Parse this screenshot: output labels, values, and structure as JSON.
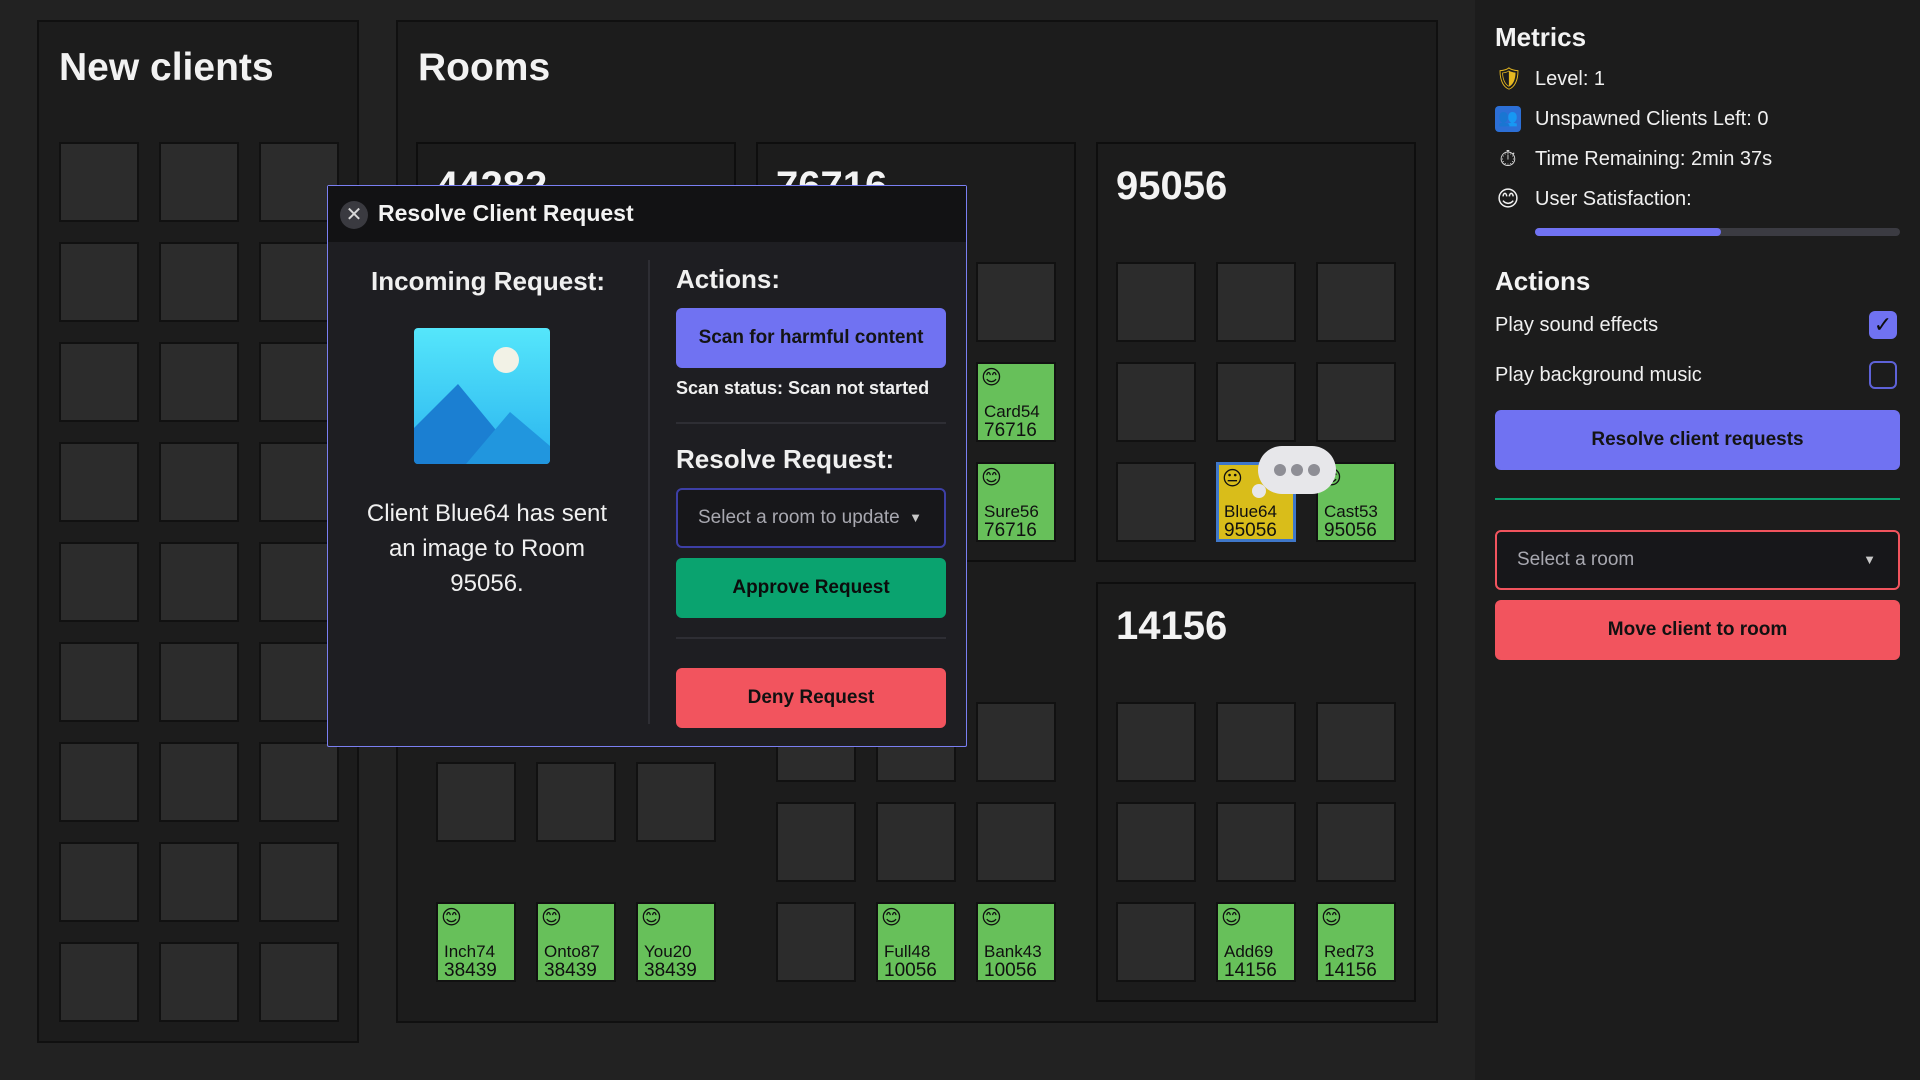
{
  "new_clients": {
    "title": "New clients"
  },
  "rooms_panel": {
    "title": "Rooms"
  },
  "rooms": [
    {
      "number": "44282",
      "clients": [
        {
          "name": "Inch74",
          "room": "38439",
          "emoji": "😊"
        },
        {
          "name": "Onto87",
          "room": "38439",
          "emoji": "😊"
        },
        {
          "name": "You20",
          "room": "38439",
          "emoji": "😊"
        }
      ]
    },
    {
      "number": "76716",
      "clients": [
        {
          "name": "Card54",
          "room": "76716",
          "emoji": "😊"
        },
        {
          "name": "Sure56",
          "room": "76716",
          "emoji": "😊"
        },
        {
          "name": "Full48",
          "room": "10056",
          "emoji": "😊"
        },
        {
          "name": "Bank43",
          "room": "10056",
          "emoji": "😊"
        }
      ]
    },
    {
      "number": "95056",
      "clients": [
        {
          "name": "Blue64",
          "room": "95056",
          "emoji": "😐"
        },
        {
          "name": "Cast53",
          "room": "95056",
          "emoji": "😊"
        }
      ]
    },
    {
      "number": "14156",
      "clients": [
        {
          "name": "Add69",
          "room": "14156",
          "emoji": "😊"
        },
        {
          "name": "Red73",
          "room": "14156",
          "emoji": "😊"
        }
      ]
    }
  ],
  "modal": {
    "title": "Resolve Client Request",
    "close_icon": "✕",
    "incoming_title": "Incoming Request:",
    "image_icon": "image-icon",
    "request_text": "Client Blue64 has sent an image to Room 95056.",
    "actions_title": "Actions:",
    "scan_button": "Scan for harmful content",
    "scan_status": "Scan status: Scan not started",
    "resolve_title": "Resolve Request:",
    "room_select_placeholder": "Select a room to update",
    "approve_button": "Approve Request",
    "deny_button": "Deny Request"
  },
  "sidebar": {
    "metrics_title": "Metrics",
    "level": {
      "label": "Level: 1",
      "icon": "🛡"
    },
    "unspawned": {
      "label": "Unspawned Clients Left: 0",
      "icon": "👥"
    },
    "time": {
      "label": "Time Remaining: 2min 37s",
      "icon": "⏱"
    },
    "satisfaction": {
      "label": "User Satisfaction:",
      "icon": "😊",
      "value": 0.51
    },
    "actions_title": "Actions",
    "sound_effects": {
      "label": "Play sound effects",
      "checked": true
    },
    "background_music": {
      "label": "Play background music",
      "checked": false
    },
    "resolve_button": "Resolve client requests",
    "room_select_placeholder": "Select a room",
    "move_button": "Move client to room"
  },
  "colors": {
    "accent": "#7072f2",
    "approve": "#0aa36f",
    "deny": "#f2545e",
    "client_ok": "#67c05a",
    "client_flag": "#d9bd1a",
    "background": "#222222"
  }
}
